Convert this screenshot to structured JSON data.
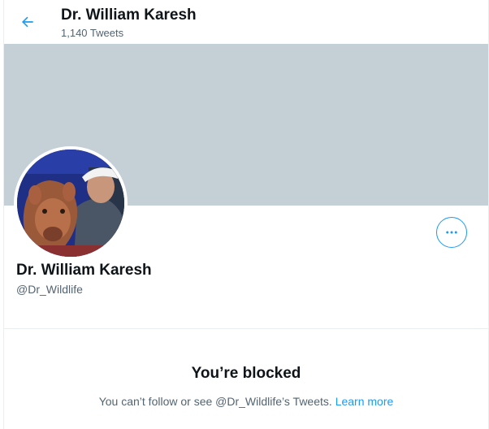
{
  "header": {
    "back_icon": "arrow-left-icon",
    "title": "Dr. William Karesh",
    "subtitle": "1,140 Tweets"
  },
  "profile": {
    "banner_color": "#c4cfd6",
    "name": "Dr. William Karesh",
    "handle": "@Dr_Wildlife",
    "more_icon": "more-horizontal-icon",
    "accent_color": "#1d9bf0"
  },
  "blocked": {
    "title": "You’re blocked",
    "message": "You can’t follow or see @Dr_Wildlife’s Tweets.",
    "learn_more": "Learn more"
  }
}
